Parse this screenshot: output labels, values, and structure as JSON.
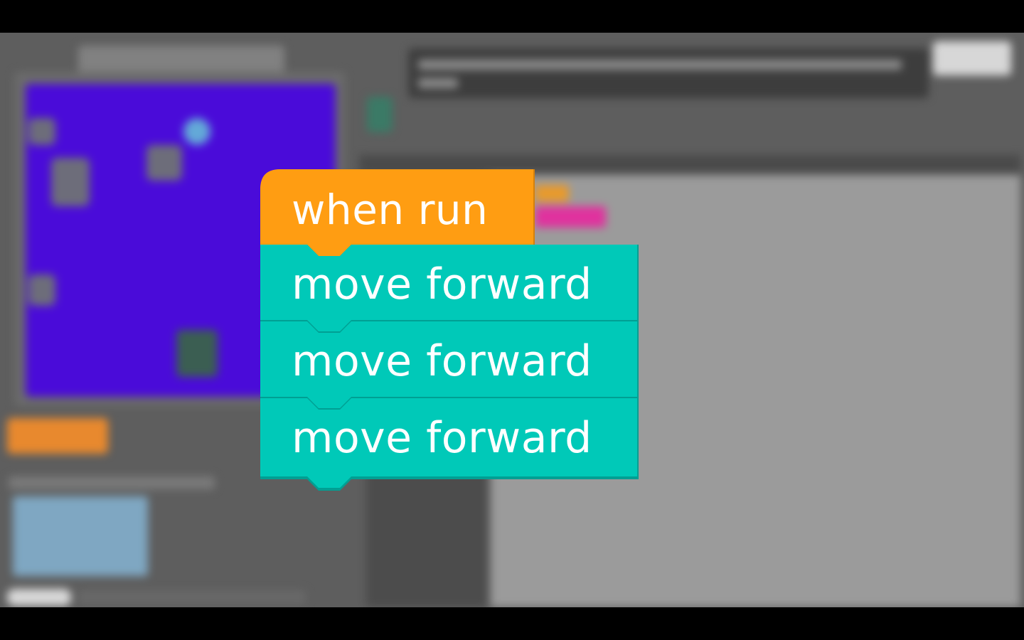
{
  "video_overlay": {
    "blocks": [
      {
        "label": "when run",
        "kind": "event",
        "color": "#ff9d12"
      },
      {
        "label": "move forward",
        "kind": "action",
        "color": "#00c9b8"
      },
      {
        "label": "move forward",
        "kind": "action",
        "color": "#00c9b8"
      },
      {
        "label": "move forward",
        "kind": "action",
        "color": "#00c9b8"
      }
    ]
  },
  "colors": {
    "event_block": "#ff9d12",
    "event_block_edge": "#d4800b",
    "action_block": "#00c9b8",
    "action_block_edge": "#009f93",
    "game_area": "#4a0bd9",
    "run_button": "#e8892e",
    "workspace": "#9b9b9b"
  },
  "background_app": {
    "blurred": true,
    "icons": [
      "gem-icon",
      "player-character-icon",
      "play-icon"
    ]
  }
}
